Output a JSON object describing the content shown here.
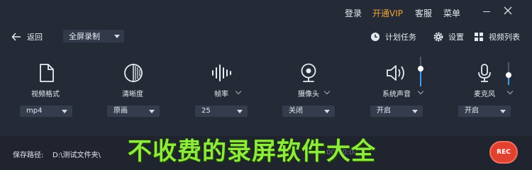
{
  "titlebar": {
    "login": "登录",
    "vip": "开通VIP",
    "service": "客服",
    "menu": "菜单"
  },
  "toolbar": {
    "back_label": "返回",
    "mode_value": "全屏录制",
    "schedule_label": "计划任务",
    "settings_label": "设置",
    "videos_label": "视频列表"
  },
  "sources": [
    {
      "label": "视频格式",
      "value": "mp4"
    },
    {
      "label": "清晰度",
      "value": "原画"
    },
    {
      "label": "帧率",
      "value": "25"
    },
    {
      "label": "摄像头",
      "value": "关闭"
    },
    {
      "label": "系统声音",
      "value": "开启",
      "volume": 0.6
    },
    {
      "label": "麦克风",
      "value": "开启",
      "volume": 0.45
    }
  ],
  "bottom": {
    "save_label": "保存路径:",
    "save_path": "D:\\测试文件夹\\",
    "timer": "00:00:00",
    "rec_label": "REC"
  },
  "overlay": {
    "caption": "不收费的录屏软件大全"
  },
  "colors": {
    "background": "#242a36",
    "accent_vip": "#f2a23a",
    "rec": "#e2412f",
    "slider": "#3aa0ff",
    "caption": "#8eea3f"
  }
}
